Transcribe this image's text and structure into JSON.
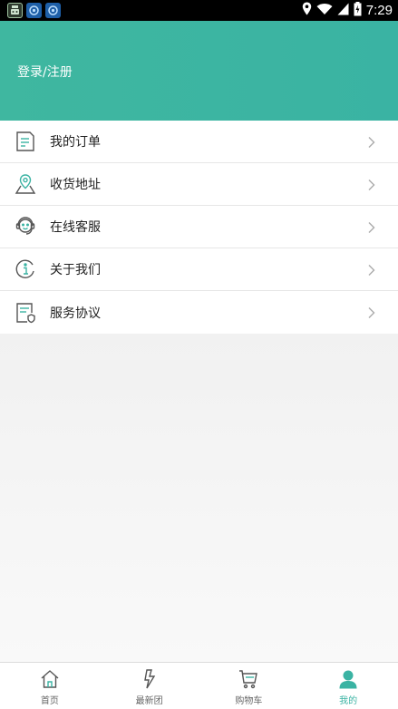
{
  "status_bar": {
    "time": "7:29",
    "left_icons": [
      "android-debug-icon",
      "app-icon",
      "app-icon"
    ],
    "right_icons": [
      "location-icon",
      "wifi-icon",
      "signal-icon",
      "battery-icon"
    ]
  },
  "header": {
    "login_label": "登录/注册",
    "color": "#3ab3a3"
  },
  "menu": {
    "items": [
      {
        "label": "我的订单",
        "icon": "order-list-icon"
      },
      {
        "label": "收货地址",
        "icon": "location-pin-icon"
      },
      {
        "label": "在线客服",
        "icon": "headset-service-icon"
      },
      {
        "label": "关于我们",
        "icon": "info-icon"
      },
      {
        "label": "服务协议",
        "icon": "agreement-shield-icon"
      }
    ]
  },
  "tabbar": {
    "active_color": "#3ab3a3",
    "items": [
      {
        "label": "首页",
        "icon": "home-icon",
        "active": false
      },
      {
        "label": "最新团",
        "icon": "lightning-icon",
        "active": false
      },
      {
        "label": "购物车",
        "icon": "cart-icon",
        "active": false
      },
      {
        "label": "我的",
        "icon": "user-icon",
        "active": true
      }
    ]
  }
}
